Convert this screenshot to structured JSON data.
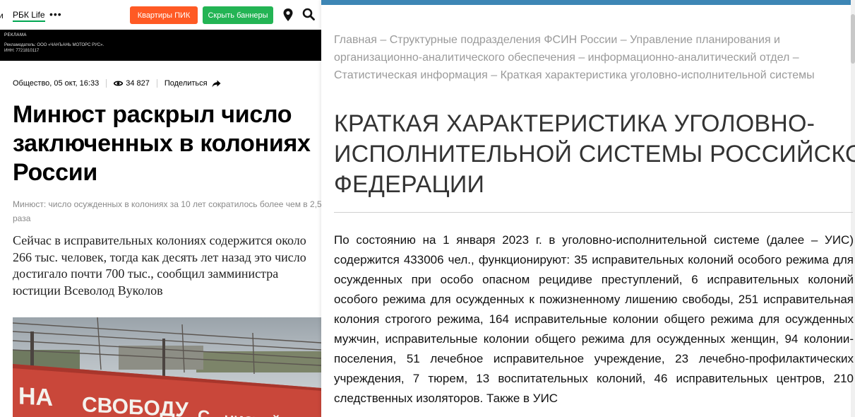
{
  "left_article": {
    "nav": {
      "cut_text": "и",
      "brand": "РБК Life",
      "more": "•••",
      "btn_pik": "Квартиры ПИК",
      "btn_hide": "Скрыть баннеры"
    },
    "ad": {
      "label": "РЕКЛАМА",
      "line1": "Рекламодатель: ООО «ЧАНЪАНЬ МОТОРС РУС».",
      "line2": "ИНН: 7721810117"
    },
    "meta": {
      "category_date": "Общество, 05 окт, 16:33",
      "views": "34 827",
      "share": "Поделиться"
    },
    "headline": "Минюст раскрыл число заключенных в колониях России",
    "lead": "Минюст: число осужденных в колониях за 10 лет сократилось более чем в 2,5 раза",
    "body": "Сейчас в исправительных колониях содержится около 266 тыс. человек, тогда как десять лет назад это число достигало почти 700 тыс., сообщил замминистра юстиции Всеволод Вуколов",
    "photo_text": "НА СВОБОДУ С ЧИСТОЙ СОВЕСТЬЮ"
  },
  "right_document": {
    "breadcrumb": "Главная – Структурные подразделения ФСИН России – Управление планирования и организационно-аналитического обеспечения – информационно-аналитический отдел – Статистическая информация – Краткая характеристика уголовно-исполнительной системы",
    "title_line1": "КРАТКАЯ ХАРАКТЕРИСТИКА УГОЛОВНО-",
    "title_line2": "ИСПОЛНИТЕЛЬНОЙ СИСТЕМЫ РОССИЙСКОЙ",
    "title_line3": "ФЕДЕРАЦИИ",
    "body": "По состоянию на 1 января 2023 г. в уголовно-исполнительной системе (далее – УИС) содержится 433006 чел., функционируют: 35 исправительных колоний особого режима для осужденных при особо опасном рецидиве преступлений, 6 исправительных колоний особого режима для осужденных к пожизненному лишению свободы, 251 исправительная колония строгого режима, 164 исправительные колонии общего режима для осужденных мужчин, исправительные колонии общего режима для осужденных женщин, 94 колонии-поселения, 51 лечебное исправительное учреждение, 23 лечебно-профилактических учреждения, 7 тюрем, 13 воспитательных колоний, 46 исправительных центров, 210 следственных изоляторов. Также в УИС"
  },
  "colors": {
    "pik_orange": "#ff5a24",
    "hide_green": "#23b454",
    "rbk_green": "#00a651",
    "fsin_blue": "#3d86b5",
    "banner_red": "#c9473a"
  },
  "icons": [
    "location-pin-icon",
    "search-icon",
    "eye-icon",
    "share-arrow-icon"
  ]
}
